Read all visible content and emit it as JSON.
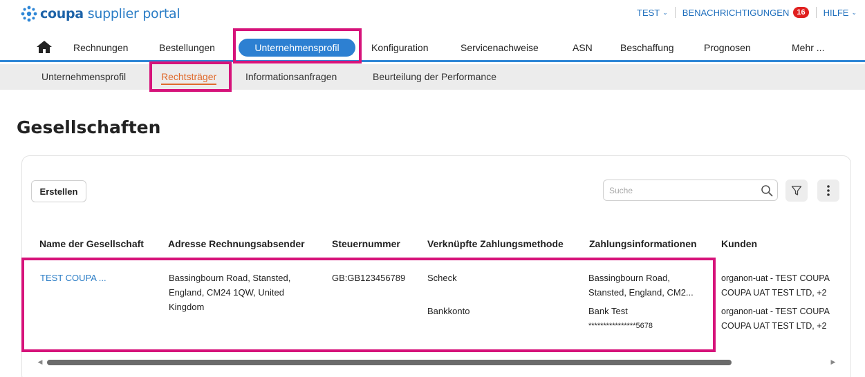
{
  "header": {
    "logo_brand": "coupa",
    "logo_rest": "supplier portal",
    "user_label": "TEST",
    "notifications_label": "BENACHRICHTIGUNGEN",
    "notifications_count": "16",
    "help_label": "HILFE"
  },
  "mainnav": {
    "items": [
      "Rechnungen",
      "Bestellungen",
      "Unternehmensprofil",
      "Konfiguration",
      "Servicenachweise",
      "ASN",
      "Beschaffung",
      "Prognosen",
      "Mehr ..."
    ],
    "active": "Unternehmensprofil"
  },
  "subnav": {
    "items": [
      "Unternehmensprofil",
      "Rechtsträger",
      "Informationsanfragen",
      "Beurteilung der Performance"
    ],
    "active": "Rechtsträger"
  },
  "page": {
    "title": "Gesellschaften",
    "create_label": "Erstellen",
    "search_placeholder": "Suche"
  },
  "table": {
    "columns": [
      "Name der Gesellschaft",
      "Adresse Rechnungsabsender",
      "Steuernummer",
      "Verknüpfte Zahlungsmethode",
      "Zahlungsinformationen",
      "Kunden"
    ],
    "row": {
      "name": "TEST COUPA ...",
      "address_lines": [
        "Bassingbourn Road, Stansted,",
        "England, CM24 1QW, United",
        "Kingdom"
      ],
      "tax_number": "GB:GB123456789",
      "payment_methods": [
        "Scheck",
        "Bankkonto"
      ],
      "payment_info_1": [
        "Bassingbourn Road,",
        "Stansted, England, CM2..."
      ],
      "payment_info_2": [
        "Bank Test",
        "****************5678"
      ],
      "customers_1": [
        "organon-uat - TEST COUPA",
        "COUPA UAT TEST LTD, +2"
      ],
      "customers_2": [
        "organon-uat - TEST COUPA",
        "COUPA UAT TEST LTD, +2"
      ]
    }
  },
  "colors": {
    "brand_blue": "#1d63a8",
    "nav_active": "#2d80d2",
    "subnav_active": "#e06a2c",
    "highlight": "#d6137a",
    "badge": "#e0201f"
  }
}
